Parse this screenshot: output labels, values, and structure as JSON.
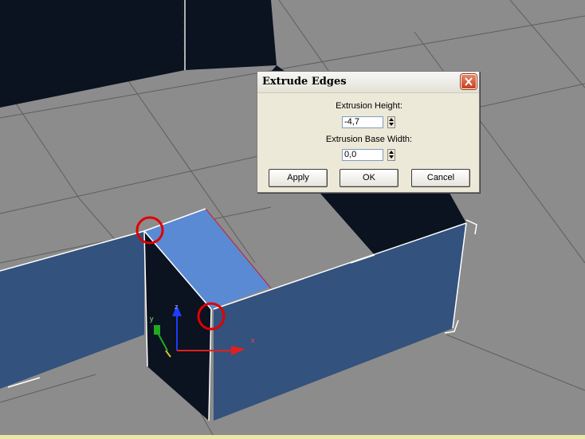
{
  "dialog": {
    "title": "Extrude Edges",
    "height_label": "Extrusion Height:",
    "height_value": "-4,7",
    "base_width_label": "Extrusion Base Width:",
    "base_width_value": "0,0",
    "apply_label": "Apply",
    "ok_label": "OK",
    "cancel_label": "Cancel"
  },
  "viewport": {
    "background_color": "#8c8c8c",
    "wall_outer_color": "#33527d",
    "wall_top_color": "#5b8ad4",
    "wall_inner_color": "#0b1220",
    "highlight_circle_color": "#e00000",
    "gizmo_axes": [
      "x",
      "y",
      "z"
    ]
  }
}
